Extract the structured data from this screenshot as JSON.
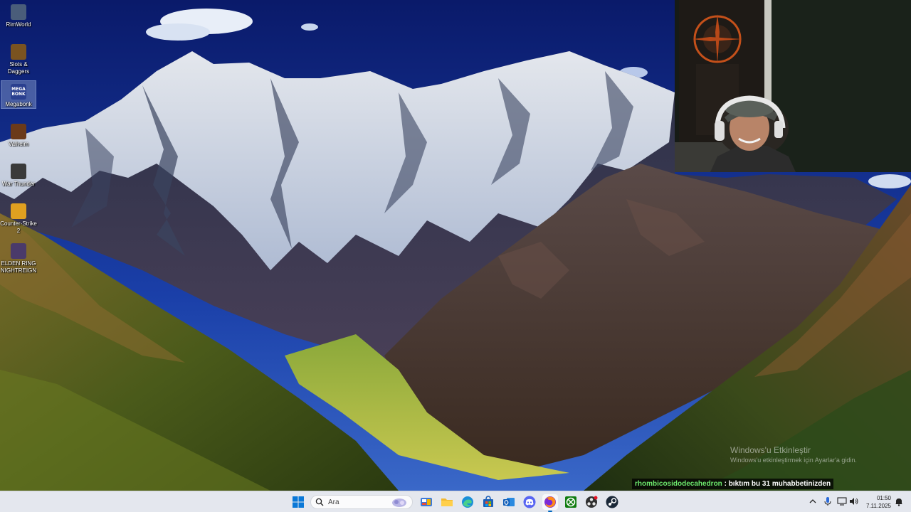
{
  "desktop": {
    "icons": [
      {
        "label": "RimWorld",
        "icon": "rimworld-icon",
        "color": "#4a5d7a",
        "glyph": "",
        "selected": false
      },
      {
        "label": "Slots & Daggers",
        "icon": "slots-daggers-icon",
        "color": "#7a5320",
        "glyph": "",
        "selected": false
      },
      {
        "label": "Megabonk",
        "icon": "megabonk-icon",
        "color": "#2a3f8f",
        "glyph": "MEGA BONK",
        "selected": true
      },
      {
        "label": "Valheim",
        "icon": "valheim-icon",
        "color": "#6b3a1a",
        "glyph": "",
        "selected": false
      },
      {
        "label": "War Thunder",
        "icon": "war-thunder-icon",
        "color": "#3a3a3a",
        "glyph": "",
        "selected": false
      },
      {
        "label": "Counter-Strike 2",
        "icon": "counter-strike-icon",
        "color": "#e0a020",
        "glyph": "",
        "selected": false
      },
      {
        "label": "ELDEN RING NIGHTREIGN",
        "icon": "elden-ring-icon",
        "color": "#4a3a6a",
        "glyph": "",
        "selected": false
      }
    ]
  },
  "watermark": {
    "title": "Windows'u Etkinleştir",
    "subtitle": "Windows'u etkinleştirmek için Ayarlar'a gidin."
  },
  "chat": {
    "username": "rhombicosidodecahedron",
    "separator": ":",
    "message": "bıktım bu 31 muhabbetinizden",
    "username_color": "#6de86d"
  },
  "taskbar": {
    "search_placeholder": "Ara",
    "pinned": [
      {
        "name": "start-button",
        "icon": "windows-start-icon",
        "active": false
      },
      {
        "name": "taskbar-app-mail",
        "icon": "mail-icon",
        "active": false
      },
      {
        "name": "taskbar-app-file-explorer",
        "icon": "folder-icon",
        "active": false
      },
      {
        "name": "taskbar-app-edge",
        "icon": "edge-icon",
        "active": false
      },
      {
        "name": "taskbar-app-store",
        "icon": "store-icon",
        "active": false
      },
      {
        "name": "taskbar-app-outlook",
        "icon": "outlook-icon",
        "active": false
      },
      {
        "name": "taskbar-app-discord",
        "icon": "discord-icon",
        "active": false
      },
      {
        "name": "taskbar-app-firefox",
        "icon": "firefox-icon",
        "active": true
      },
      {
        "name": "taskbar-app-xbox",
        "icon": "xbox-icon",
        "active": false
      },
      {
        "name": "taskbar-app-obs",
        "icon": "obs-icon",
        "active": false
      },
      {
        "name": "taskbar-app-steam",
        "icon": "steam-icon",
        "active": false
      }
    ],
    "clock": {
      "time": "01:50",
      "date": "7.11.2025"
    }
  }
}
